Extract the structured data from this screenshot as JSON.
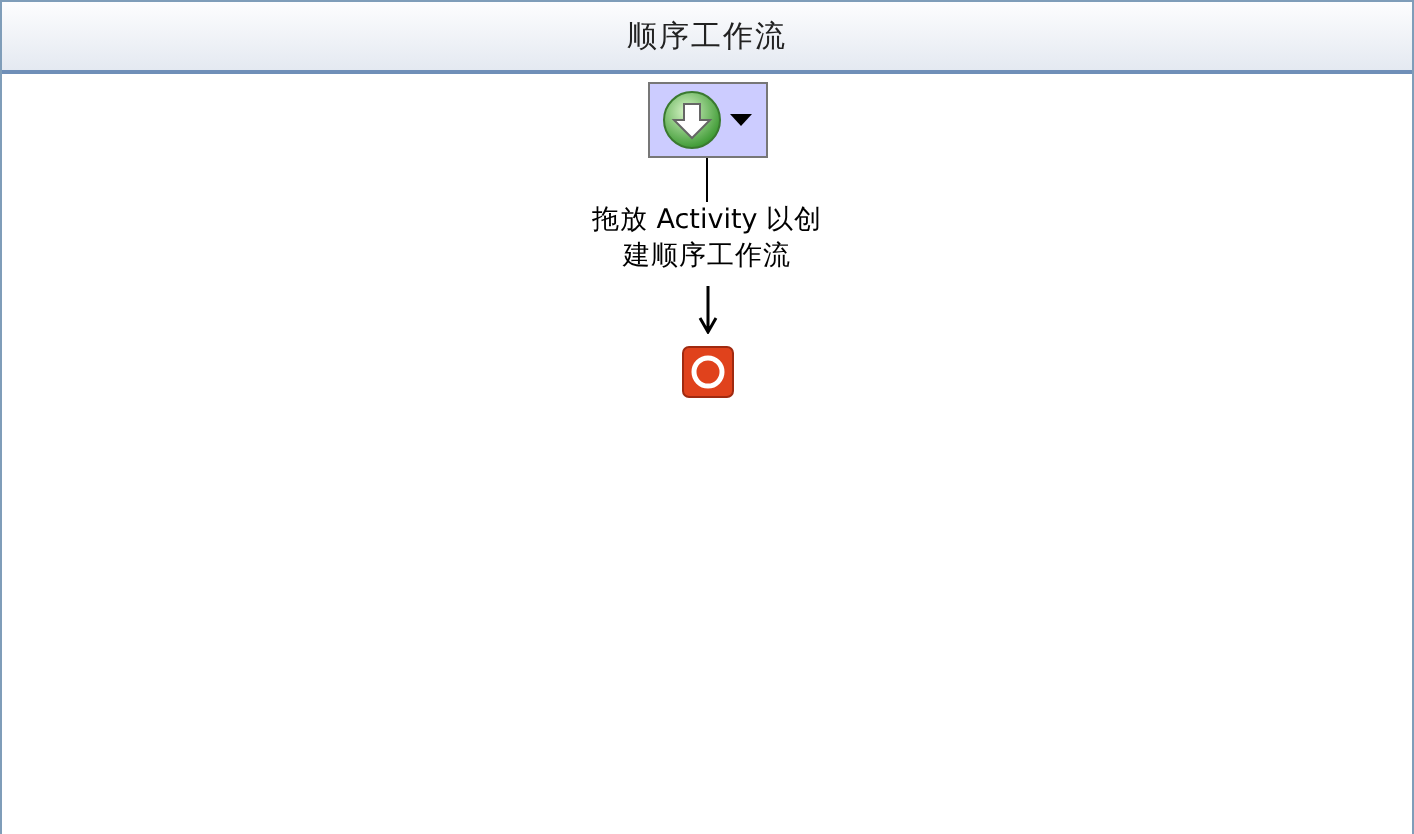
{
  "window": {
    "title": "顺序工作流"
  },
  "hint": "拖放 Activity 以创建顺序工作流"
}
